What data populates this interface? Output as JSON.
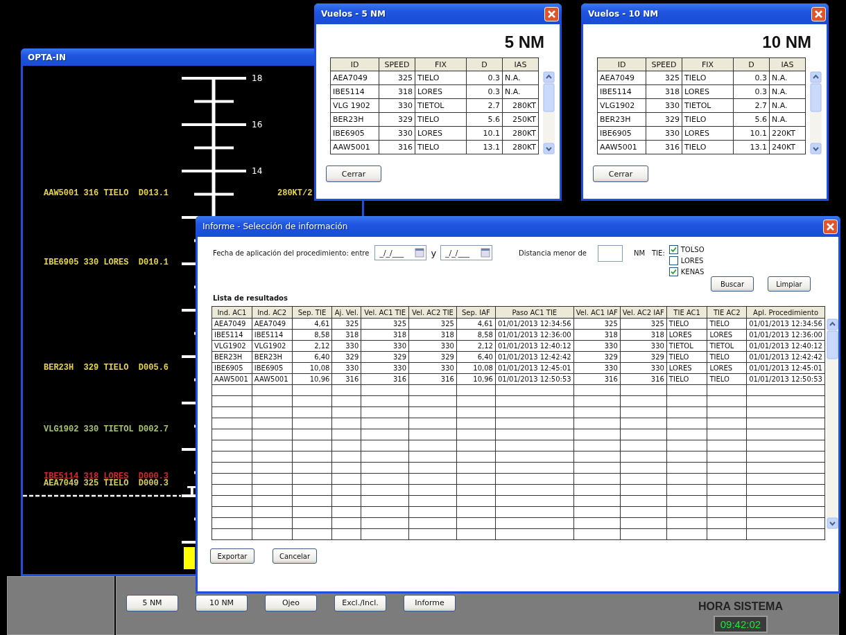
{
  "main_window": {
    "title": "OPTA-IN",
    "scale_labels": [
      "18",
      "16",
      "14"
    ],
    "flight_labels": [
      {
        "text": "AAW5001 316 TIELO  D013.1",
        "color": "#e6d54a"
      },
      {
        "text": "IBE6905 330 LORES  D010.1",
        "color": "#e6d54a"
      },
      {
        "text": "BER23H  329 TIELO  D005.6",
        "color": "#e6d54a"
      },
      {
        "text": "VLG1902 330 TIETOL D002.7",
        "color": "#a8c46a"
      },
      {
        "text": "IBE5114 318 LORES  D000.3",
        "color": "#d4282a"
      },
      {
        "text": "AEA7049 325 TIELO  D000.3",
        "color": "#d6d060"
      }
    ],
    "speed_label": "280KT/2",
    "threshold_marker": "T"
  },
  "flight_windows": [
    {
      "title": "Vuelos - 5 NM",
      "heading": "5 NM",
      "columns": [
        "ID",
        "SPEED",
        "FIX",
        "D",
        "IAS"
      ],
      "rows": [
        [
          "AEA7049",
          "325",
          "TIELO",
          "0.3",
          "N.A."
        ],
        [
          "IBE5114",
          "318",
          "LORES",
          "0.3",
          "N.A."
        ],
        [
          "VLG 1902",
          "330",
          "TIETOL",
          "2.7",
          "280KT"
        ],
        [
          "BER23H",
          "329",
          "TIELO",
          "5.6",
          "250KT"
        ],
        [
          "IBE6905",
          "330",
          "LORES",
          "10.1",
          "280KT"
        ],
        [
          "AAW5001",
          "316",
          "TIELO",
          "13.1",
          "280KT"
        ]
      ],
      "close_button": "Cerrar"
    },
    {
      "title": "Vuelos - 10 NM",
      "heading": "10 NM",
      "columns": [
        "ID",
        "SPEED",
        "FIX",
        "D",
        "IAS"
      ],
      "rows": [
        [
          "AEA7049",
          "325",
          "TIELO",
          "0.3",
          "N.A."
        ],
        [
          "IBE5114",
          "318",
          "LORES",
          "0.3",
          "N.A."
        ],
        [
          "VLG1902",
          "330",
          "TIETOL",
          "2.7",
          "N.A."
        ],
        [
          "BER23H",
          "329",
          "TIELO",
          "5.6",
          "N.A."
        ],
        [
          "IBE6905",
          "330",
          "LORES",
          "10.1",
          "220KT"
        ],
        [
          "AAW5001",
          "316",
          "TIELO",
          "13.1",
          "240KT"
        ]
      ],
      "close_button": "Cerrar"
    }
  ],
  "report_window": {
    "title": "Informe - Selección de información",
    "date_label": "Fecha de aplicación del procedimiento: entre",
    "date_from": {
      "placeholder": "_/_/___"
    },
    "date_joiner": "y",
    "date_to": {
      "placeholder": "_/_/___"
    },
    "distance_label": "Distancia menor de",
    "distance_unit": "NM",
    "tie_label": "TIE:",
    "tie_options": [
      {
        "label": "TOLSO",
        "checked": true
      },
      {
        "label": "LORES",
        "checked": false
      },
      {
        "label": "KENAS",
        "checked": true
      }
    ],
    "search_buttons": [
      "Buscar",
      "Limpiar"
    ],
    "results_title": "Lista de resultados",
    "columns": [
      "Ind. AC1",
      "Ind. AC2",
      "Sep. TIE",
      "Aj. Vel.",
      "Vel. AC1 TIE",
      "Vel. AC2 TIE",
      "Sep. IAF",
      "Paso AC1 TIE",
      "Vel. AC1 IAF",
      "Vel. AC2 IAF",
      "TIE AC1",
      "TIE AC2",
      "Apl. Procedimiento"
    ],
    "rows": [
      [
        "AEA7049",
        "AEA7049",
        "4,61",
        "325",
        "325",
        "325",
        "4,61",
        "01/01/2013 12:34:56",
        "325",
        "325",
        "TIELO",
        "TIELO",
        "01/01/2013 12:34:56"
      ],
      [
        "IBE5114",
        "IBE5114",
        "8,58",
        "318",
        "318",
        "318",
        "8,58",
        "01/01/2013 12:36:00",
        "318",
        "318",
        "LORES",
        "LORES",
        "01/01/2013 12:36:00"
      ],
      [
        "VLG1902",
        "VLG1902",
        "2,12",
        "330",
        "330",
        "330",
        "2,12",
        "01/01/2013 12:40:12",
        "330",
        "330",
        "TIETOL",
        "TIETOL",
        "01/01/2013 12:40:12"
      ],
      [
        "BER23H",
        "BER23H",
        "6,40",
        "329",
        "329",
        "329",
        "6,40",
        "01/01/2013 12:42:42",
        "329",
        "329",
        "TIELO",
        "TIELO",
        "01/01/2013 12:42:42"
      ],
      [
        "IBE6905",
        "IBE6905",
        "10,08",
        "330",
        "330",
        "330",
        "10,08",
        "01/01/2013 12:45:01",
        "330",
        "330",
        "LORES",
        "LORES",
        "01/01/2013 12:45:01"
      ],
      [
        "AAW5001",
        "AAW5001",
        "10,96",
        "316",
        "316",
        "316",
        "10,96",
        "01/01/2013 12:50:53",
        "316",
        "316",
        "TIELO",
        "TIELO",
        "01/01/2013 12:50:53"
      ]
    ],
    "footer_buttons": [
      "Exportar",
      "Cancelar"
    ]
  },
  "bottom_bar": {
    "buttons": [
      "5 NM",
      "10 NM",
      "Ojeo",
      "Excl./Incl.",
      "Informe"
    ],
    "clock_label": "HORA SISTEMA",
    "clock": "09:42:02"
  }
}
